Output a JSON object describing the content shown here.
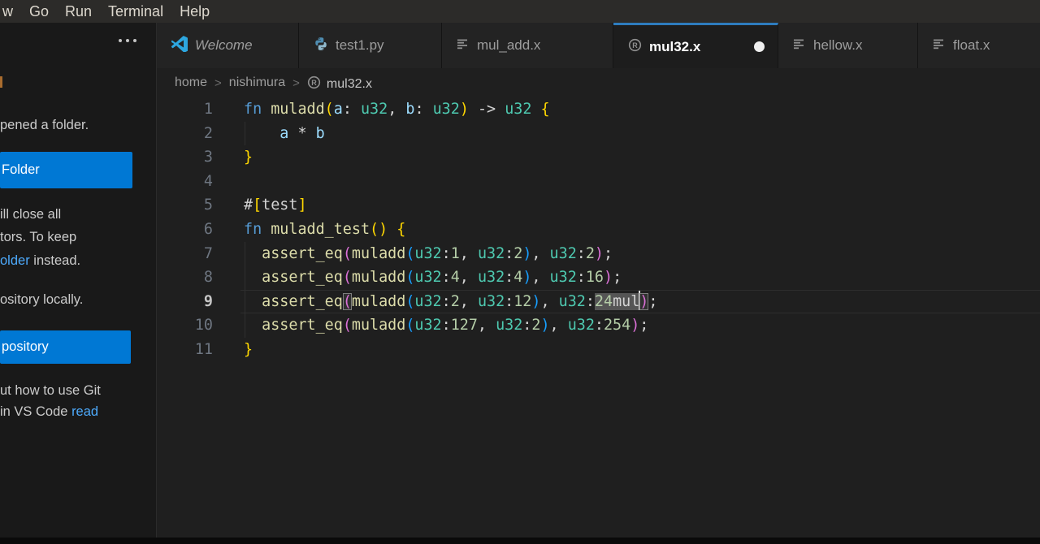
{
  "menubar": {
    "items": [
      "w",
      "Go",
      "Run",
      "Terminal",
      "Help"
    ]
  },
  "tabbar": {
    "tabs": [
      {
        "label": "Welcome",
        "icon": "vscode-logo",
        "italic": true,
        "active": false,
        "modified": false
      },
      {
        "label": "test1.py",
        "icon": "python",
        "italic": false,
        "active": false,
        "modified": false
      },
      {
        "label": "mul_add.x",
        "icon": "file-lines",
        "italic": false,
        "active": false,
        "modified": false
      },
      {
        "label": "mul32.x",
        "icon": "rust",
        "italic": false,
        "active": true,
        "modified": true
      },
      {
        "label": "hellow.x",
        "icon": "file-lines",
        "italic": false,
        "active": false,
        "modified": false
      },
      {
        "label": "float.x",
        "icon": "file-lines",
        "italic": false,
        "active": false,
        "modified": false
      }
    ]
  },
  "breadcrumb": {
    "items": [
      "home",
      "nishimura",
      "mul32.x"
    ],
    "last_item_icon": "rust"
  },
  "sidebar": {
    "text_opened_folder": "pened a folder.",
    "open_folder_button": "Folder",
    "text_close_1": "ill close all",
    "text_close_2": "tors. To keep",
    "text_close_3_link": "older",
    "text_close_3_rest": " instead.",
    "text_clone": "ository locally.",
    "clone_button": "pository",
    "text_git_1": "ut how to use Git",
    "text_git_2": "in VS Code ",
    "text_git_2_link": "read"
  },
  "editor": {
    "current_line": 9,
    "lines": [
      {
        "n": 1,
        "guide": false,
        "segs": [
          [
            "kw",
            "fn"
          ],
          [
            "pl",
            " "
          ],
          [
            "fn",
            "muladd"
          ],
          [
            "b1",
            "("
          ],
          [
            "var",
            "a"
          ],
          [
            "pl",
            ": "
          ],
          [
            "ty",
            "u32"
          ],
          [
            "pl",
            ", "
          ],
          [
            "var",
            "b"
          ],
          [
            "pl",
            ": "
          ],
          [
            "ty",
            "u32"
          ],
          [
            "b1",
            ")"
          ],
          [
            "pl",
            " -> "
          ],
          [
            "ty",
            "u32"
          ],
          [
            "pl",
            " "
          ],
          [
            "b1",
            "{"
          ]
        ]
      },
      {
        "n": 2,
        "guide": true,
        "segs": [
          [
            "pl",
            "    "
          ],
          [
            "var",
            "a"
          ],
          [
            "pl",
            " * "
          ],
          [
            "var",
            "b"
          ]
        ]
      },
      {
        "n": 3,
        "guide": false,
        "segs": [
          [
            "b1",
            "}"
          ]
        ]
      },
      {
        "n": 4,
        "guide": false,
        "segs": []
      },
      {
        "n": 5,
        "guide": false,
        "segs": [
          [
            "pl",
            "#"
          ],
          [
            "b1",
            "["
          ],
          [
            "pl",
            "test"
          ],
          [
            "b1",
            "]"
          ]
        ]
      },
      {
        "n": 6,
        "guide": false,
        "segs": [
          [
            "kw",
            "fn"
          ],
          [
            "pl",
            " "
          ],
          [
            "fn",
            "muladd_test"
          ],
          [
            "b1",
            "()"
          ],
          [
            "pl",
            " "
          ],
          [
            "b1",
            "{"
          ]
        ]
      },
      {
        "n": 7,
        "guide": true,
        "segs": [
          [
            "pl",
            "  "
          ],
          [
            "fn",
            "assert_eq"
          ],
          [
            "b2",
            "("
          ],
          [
            "fn",
            "muladd"
          ],
          [
            "b3",
            "("
          ],
          [
            "ty",
            "u32"
          ],
          [
            "pl",
            ":"
          ],
          [
            "num",
            "1"
          ],
          [
            "pl",
            ", "
          ],
          [
            "ty",
            "u32"
          ],
          [
            "pl",
            ":"
          ],
          [
            "num",
            "2"
          ],
          [
            "b3",
            ")"
          ],
          [
            "pl",
            ", "
          ],
          [
            "ty",
            "u32"
          ],
          [
            "pl",
            ":"
          ],
          [
            "num",
            "2"
          ],
          [
            "b2",
            ")"
          ],
          [
            "pl",
            ";"
          ]
        ]
      },
      {
        "n": 8,
        "guide": true,
        "segs": [
          [
            "pl",
            "  "
          ],
          [
            "fn",
            "assert_eq"
          ],
          [
            "b2",
            "("
          ],
          [
            "fn",
            "muladd"
          ],
          [
            "b3",
            "("
          ],
          [
            "ty",
            "u32"
          ],
          [
            "pl",
            ":"
          ],
          [
            "num",
            "4"
          ],
          [
            "pl",
            ", "
          ],
          [
            "ty",
            "u32"
          ],
          [
            "pl",
            ":"
          ],
          [
            "num",
            "4"
          ],
          [
            "b3",
            ")"
          ],
          [
            "pl",
            ", "
          ],
          [
            "ty",
            "u32"
          ],
          [
            "pl",
            ":"
          ],
          [
            "num",
            "16"
          ],
          [
            "b2",
            ")"
          ],
          [
            "pl",
            ";"
          ]
        ]
      },
      {
        "n": 9,
        "guide": true,
        "segs": [
          [
            "pl",
            "  "
          ],
          [
            "fn",
            "assert_eq"
          ],
          [
            "b2 bm",
            "("
          ],
          [
            "fn",
            "muladd"
          ],
          [
            "b3",
            "("
          ],
          [
            "ty",
            "u32"
          ],
          [
            "pl",
            ":"
          ],
          [
            "num",
            "2"
          ],
          [
            "pl",
            ", "
          ],
          [
            "ty",
            "u32"
          ],
          [
            "pl",
            ":"
          ],
          [
            "num",
            "12"
          ],
          [
            "b3",
            ")"
          ],
          [
            "pl",
            ", "
          ],
          [
            "ty",
            "u32"
          ],
          [
            "pl",
            ":"
          ],
          [
            "num sel",
            "24"
          ],
          [
            "pl sel",
            "mul"
          ],
          [
            "caret",
            ""
          ],
          [
            "b2 bm",
            ")"
          ],
          [
            "pl",
            ";"
          ]
        ]
      },
      {
        "n": 10,
        "guide": true,
        "segs": [
          [
            "pl",
            "  "
          ],
          [
            "fn",
            "assert_eq"
          ],
          [
            "b2",
            "("
          ],
          [
            "fn",
            "muladd"
          ],
          [
            "b3",
            "("
          ],
          [
            "ty",
            "u32"
          ],
          [
            "pl",
            ":"
          ],
          [
            "num",
            "127"
          ],
          [
            "pl",
            ", "
          ],
          [
            "ty",
            "u32"
          ],
          [
            "pl",
            ":"
          ],
          [
            "num",
            "2"
          ],
          [
            "b3",
            ")"
          ],
          [
            "pl",
            ", "
          ],
          [
            "ty",
            "u32"
          ],
          [
            "pl",
            ":"
          ],
          [
            "num",
            "254"
          ],
          [
            "b2",
            ")"
          ],
          [
            "pl",
            ";"
          ]
        ]
      },
      {
        "n": 11,
        "guide": false,
        "segs": [
          [
            "b1",
            "}"
          ]
        ]
      }
    ]
  },
  "colors": {
    "accent_button": "#0078d4",
    "link": "#4daafc",
    "active_tab_border": "#2e7cbe",
    "modified_dot": "#efefef",
    "keyword": "#569cd6",
    "function": "#dcdcaa",
    "type": "#4ec9b0",
    "number": "#b5cea8",
    "variable": "#9cdcfe",
    "punctuation": "#d4d4d4",
    "bracket_level1": "#ffd700",
    "bracket_level2": "#da70d6",
    "bracket_level3": "#179fff"
  }
}
